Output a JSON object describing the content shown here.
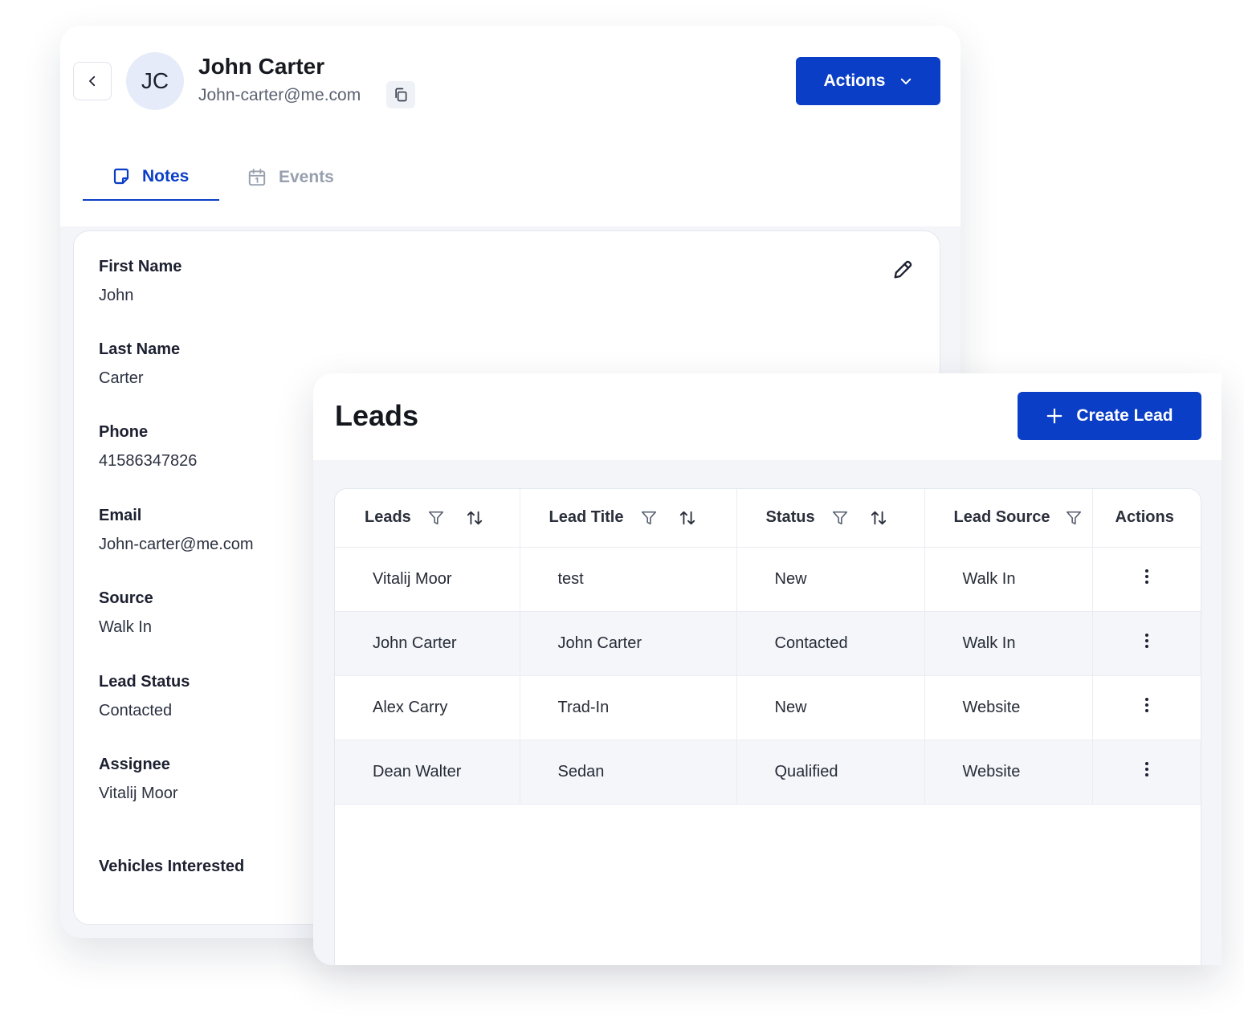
{
  "contact": {
    "initials": "JC",
    "name": "John Carter",
    "email": "John-carter@me.com",
    "actions_label": "Actions",
    "tabs": [
      {
        "label": "Notes",
        "active": true
      },
      {
        "label": "Events",
        "active": false
      }
    ],
    "fields": [
      {
        "label": "First Name",
        "value": "John"
      },
      {
        "label": "Last Name",
        "value": "Carter"
      },
      {
        "label": "Phone",
        "value": "41586347826"
      },
      {
        "label": "Email",
        "value": "John-carter@me.com"
      },
      {
        "label": "Source",
        "value": "Walk In"
      },
      {
        "label": "Lead Status",
        "value": "Contacted"
      },
      {
        "label": "Assignee",
        "value": "Vitalij Moor"
      },
      {
        "label": "Vehicles Interested",
        "value": ""
      }
    ]
  },
  "leads": {
    "title": "Leads",
    "create_label": "Create Lead",
    "columns": [
      "Leads",
      "Lead Title",
      "Status",
      "Lead Source",
      "Actions"
    ],
    "rows": [
      {
        "lead": "Vitalij Moor",
        "title": "test",
        "status": "New",
        "source": "Walk In"
      },
      {
        "lead": "John Carter",
        "title": "John Carter",
        "status": "Contacted",
        "source": "Walk In"
      },
      {
        "lead": "Alex Carry",
        "title": "Trad-In",
        "status": "New",
        "source": "Website"
      },
      {
        "lead": "Dean Walter",
        "title": "Sedan",
        "status": "Qualified",
        "source": "Website"
      }
    ]
  },
  "colors": {
    "primary": "#0a3ec6",
    "panel_bg": "#f3f5f9",
    "muted_text": "#98a0ae",
    "avatar_bg": "#e6ebf9"
  },
  "icons": {
    "back": "chevron-left-icon",
    "copy": "copy-icon",
    "actions_caret": "chevron-down-icon",
    "notes_tab": "note-icon",
    "events_tab": "calendar-icon",
    "edit": "pencil-icon",
    "create": "plus-icon",
    "filter": "filter-icon",
    "sort": "sort-icon",
    "row_menu": "more-vertical-icon"
  }
}
